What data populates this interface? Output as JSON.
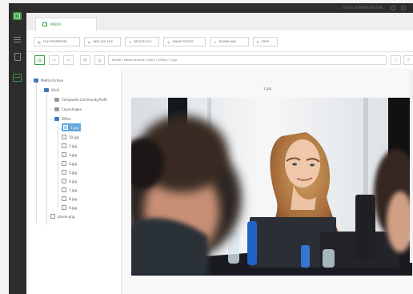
{
  "topbar": {
    "admin": "SITES ADMINISTRATOR"
  },
  "tab": {
    "label": "MEDIA"
  },
  "toolbar": [
    {
      "label": "FILE PROPERTIES",
      "icon": "properties-icon"
    },
    {
      "label": "REPLACE FILE",
      "icon": "replace-icon"
    },
    {
      "label": "DELETE FILE",
      "icon": "delete-icon"
    },
    {
      "label": "IMAGE EDITOR",
      "icon": "image-editor-icon"
    },
    {
      "label": "DOWNLOAD",
      "icon": "download-icon"
    },
    {
      "label": "CROP",
      "icon": "crop-icon"
    }
  ],
  "breadcrumb": "Media / Media Archive / Site3 / Office / 1.jpg",
  "tree": {
    "root": "Media Archive",
    "site": "Site3",
    "folders": [
      "Composite.Community.Profil",
      "Copenhagen",
      "Office"
    ],
    "files": [
      "1.jpg",
      "10.jpg",
      "2.jpg",
      "3.jpg",
      "4.jpg",
      "5.jpg",
      "6.jpg",
      "7.jpg",
      "8.jpg",
      "9.jpg"
    ],
    "extra_file": "phone.png"
  },
  "preview": {
    "filename": "1.jpg"
  },
  "colors": {
    "accent": "#3c9a48",
    "selection": "#61a7dd",
    "chrome": "#2d2d2d"
  }
}
